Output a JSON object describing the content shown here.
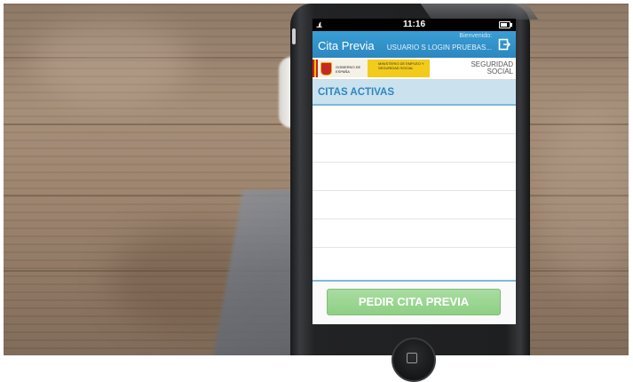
{
  "statusbar": {
    "signal": "..ıl.",
    "time": "11:16"
  },
  "header": {
    "title": "Cita Previa",
    "welcome_label": "Bienvenido:",
    "username": "USUARIO S LOGIN PRUEBAS..."
  },
  "logos": {
    "government": "GOBIERNO DE ESPAÑA",
    "ministry": "MINISTERIO DE EMPLEO Y SEGURIDAD SOCIAL",
    "brand_line1": "SEGURIDAD",
    "brand_line2": "SOCIAL"
  },
  "section": {
    "title": "CITAS ACTIVAS"
  },
  "list": {
    "rows": [
      "",
      "",
      "",
      "",
      "",
      ""
    ]
  },
  "footer": {
    "button_label": "PEDIR CITA PREVIA"
  },
  "colors": {
    "primary": "#2b87c0",
    "section_background": "#c9e2ee",
    "button_green": "#8fcf85"
  },
  "icons": {
    "logout": "logout-icon",
    "battery": "battery-icon",
    "signal": "signal-icon"
  }
}
